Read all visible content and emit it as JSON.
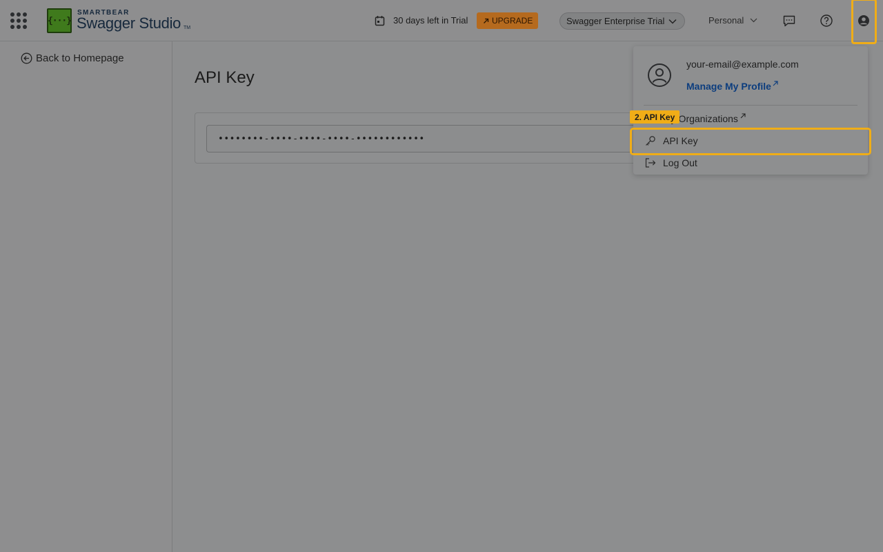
{
  "header": {
    "brand_top": "SMARTBEAR",
    "brand_main": "Swagger Studio",
    "brand_tm": "TM",
    "logo_glyph": "{···}",
    "trial_text": "30 days left in Trial",
    "upgrade_label": "UPGRADE",
    "plan_label": "Swagger Enterprise Trial",
    "workspace_label": "Personal"
  },
  "sidebar": {
    "back_label": "Back to Homepage"
  },
  "main": {
    "title": "API Key",
    "api_key_value": "••••••••-••••-••••-••••-••••••••••••"
  },
  "user_menu": {
    "email": "your-email@example.com",
    "manage_profile": "Manage My Profile",
    "organizations": "My Organizations",
    "api_key": "API Key",
    "log_out": "Log Out"
  },
  "highlight": {
    "tag": "2. API Key",
    "color": "#f0ad17"
  },
  "colors": {
    "upgrade": "#b56a1e",
    "link": "#0c3d7e",
    "logo": "#3f7a1c"
  },
  "icons": [
    "apps-grid-icon",
    "calendar-icon",
    "external-arrow-icon",
    "chevron-down-icon",
    "chat-icon",
    "help-icon",
    "user-icon",
    "back-arrow-icon",
    "key-icon",
    "logout-icon"
  ]
}
